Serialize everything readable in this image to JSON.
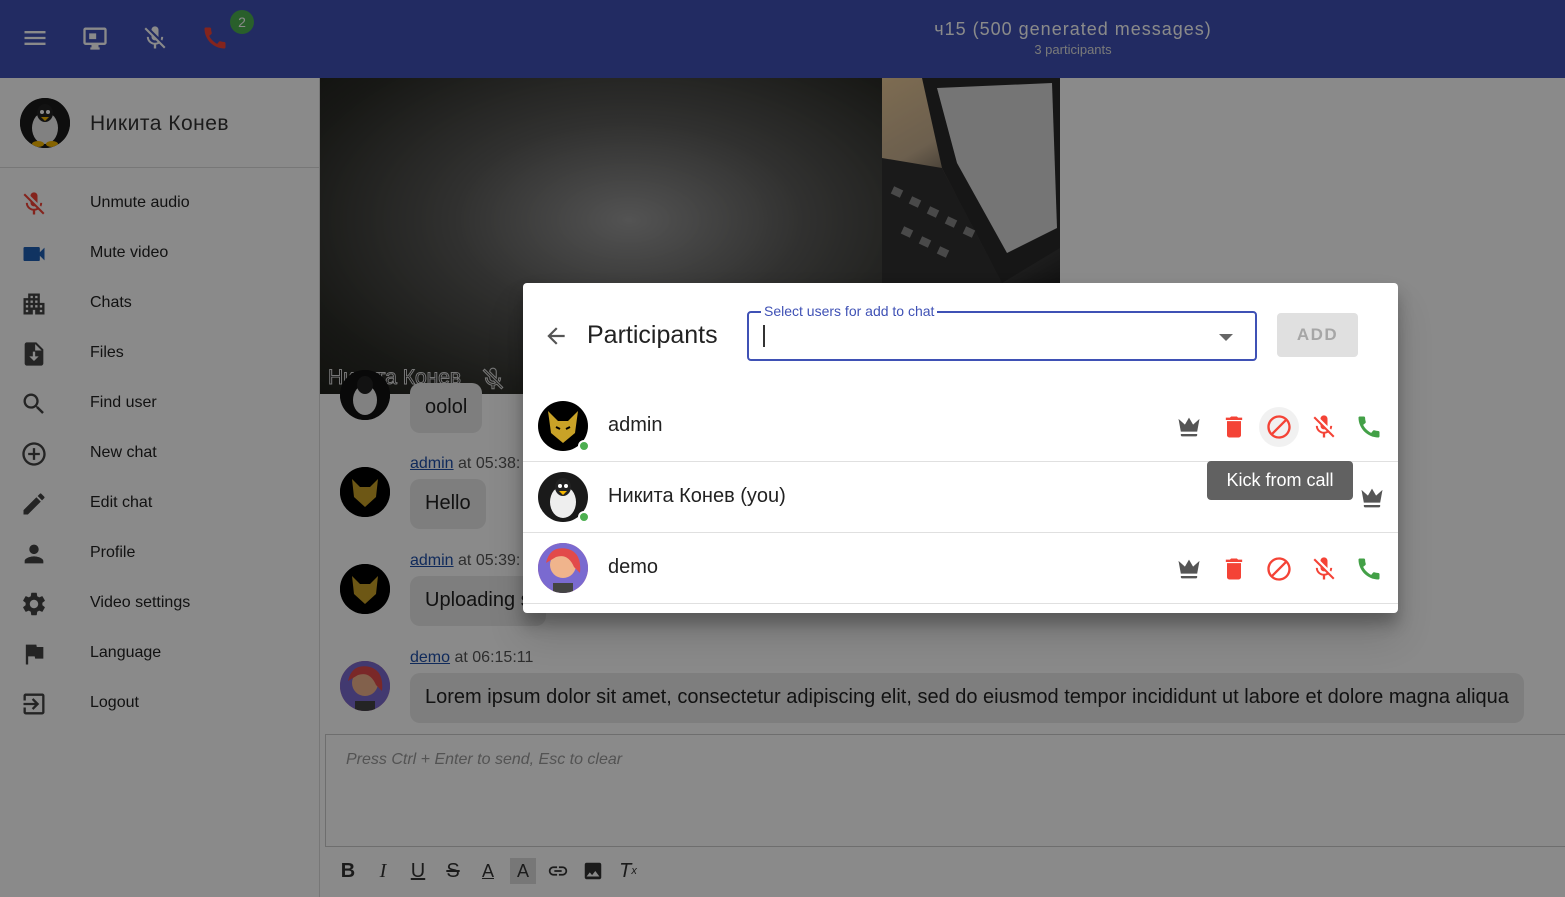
{
  "topbar": {
    "badge_count": "2",
    "title": "ч15 (500 generated messages)",
    "subtitle": "3 participants",
    "icons": [
      "menu-icon",
      "screen-share-icon",
      "mic-off-icon",
      "phone-icon"
    ],
    "color": "#3f51b5"
  },
  "sidebar": {
    "user_name": "Никита Конев",
    "items": [
      {
        "label": "Unmute audio",
        "icon": "mic-off-icon"
      },
      {
        "label": "Mute video",
        "icon": "videocam-icon"
      },
      {
        "label": "Chats",
        "icon": "chats-icon"
      },
      {
        "label": "Files",
        "icon": "file-download-icon"
      },
      {
        "label": "Find user",
        "icon": "search-icon"
      },
      {
        "label": "New chat",
        "icon": "add-circle-icon"
      },
      {
        "label": "Edit chat",
        "icon": "pencil-icon"
      },
      {
        "label": "Profile",
        "icon": "person-icon"
      },
      {
        "label": "Video settings",
        "icon": "gear-icon"
      },
      {
        "label": "Language",
        "icon": "flag-icon"
      },
      {
        "label": "Logout",
        "icon": "logout-icon"
      }
    ]
  },
  "video": {
    "label": "Никита Конев"
  },
  "messages": [
    {
      "author": "",
      "time": "",
      "text": "oolol"
    },
    {
      "author": "admin",
      "time": "at 05:38:",
      "text": "Hello"
    },
    {
      "author": "admin",
      "time": "at 05:39:",
      "text": "Uploading s"
    },
    {
      "author": "demo",
      "time": "at 06:15:11",
      "text": "Lorem ipsum dolor sit amet, consectetur adipiscing elit, sed do eiusmod tempor incididunt ut labore et dolore magna aliqua"
    }
  ],
  "editor": {
    "placeholder": "Press Ctrl + Enter to send, Esc to clear",
    "format_buttons": [
      "bold",
      "italic",
      "underline",
      "strikethrough",
      "text-color",
      "highlight",
      "link",
      "image",
      "clear-format"
    ]
  },
  "dialog": {
    "title": "Participants",
    "select_label": "Select users for add to chat",
    "add_label": "ADD",
    "participants": [
      {
        "name": "admin",
        "online": true
      },
      {
        "name": "Никита Конев (you)",
        "online": true
      },
      {
        "name": "demo",
        "online": false
      }
    ],
    "tooltip": "Kick from call",
    "colors": {
      "danger": "#f44336",
      "call": "#43a047",
      "admin": "#555555"
    }
  }
}
